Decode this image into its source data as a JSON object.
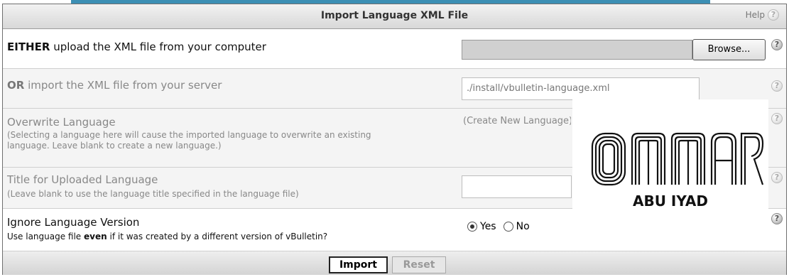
{
  "header": {
    "title": "Import Language XML File",
    "help_label": "Help",
    "help_icon": "question-icon"
  },
  "rows": {
    "upload": {
      "prefix": "EITHER",
      "label": "upload the XML file from your computer",
      "file_path_value": "",
      "browse_label": "Browse..."
    },
    "server": {
      "prefix": "OR",
      "label": "import the XML file from your server",
      "path_value": "./install/vbulletin-language.xml"
    },
    "overwrite": {
      "label": "Overwrite Language",
      "description": "(Selecting a language here will cause the imported language to overwrite an existing language. Leave blank to create a new language.)",
      "selected_option": "(Create New Language)"
    },
    "title": {
      "label": "Title for Uploaded Language",
      "description": "(Leave blank to use the language title specified in the language file)",
      "value": ""
    },
    "ignore_version": {
      "label": "Ignore Language Version",
      "description_before": "Use language file",
      "description_emph": "even",
      "description_after": "if it was created by a different version of vBulletin?",
      "option_yes": "Yes",
      "option_no": "No",
      "selected": "Yes"
    }
  },
  "footer": {
    "import_label": "Import",
    "reset_label": "Reset"
  },
  "watermark": {
    "logo_text": "OMAR",
    "sub_text": "ABU IYAD"
  },
  "colors": {
    "top_strip": "#3c8fb4",
    "header_bg": "#e2e2e2",
    "muted_text": "#888888"
  }
}
